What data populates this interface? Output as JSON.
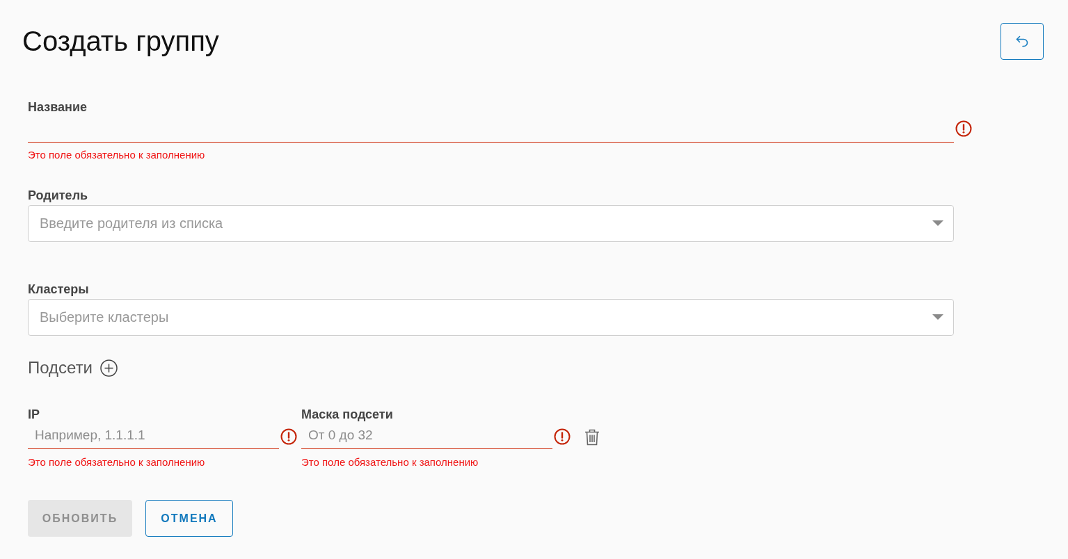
{
  "title": "Создать группу",
  "fields": [
    {
      "kind": "text",
      "label": "Название",
      "invalid": true,
      "error": "Это поле обязательно к заполнению"
    },
    {
      "kind": "select",
      "label": "Родитель",
      "placeholder": "Введите родителя из списка"
    },
    {
      "kind": "select",
      "label": "Кластеры",
      "placeholder": "Выберите кластеры"
    }
  ],
  "subnets": {
    "heading": "Подсети",
    "rows": [
      {
        "fields": [
          {
            "label": "IP",
            "placeholder": "Например, 1.1.1.1",
            "invalid": true,
            "error": "Это поле обязательно к заполнению"
          },
          {
            "label": "Маска подсети",
            "placeholder": "От 0 до 32",
            "invalid": true,
            "error": "Это поле обязательно к заполнению"
          }
        ]
      }
    ]
  },
  "buttons": [
    {
      "kind": "filled",
      "label": "ОБНОВИТЬ",
      "disabled": true
    },
    {
      "kind": "outlined",
      "label": "ОТМЕНА",
      "disabled": false
    }
  ]
}
